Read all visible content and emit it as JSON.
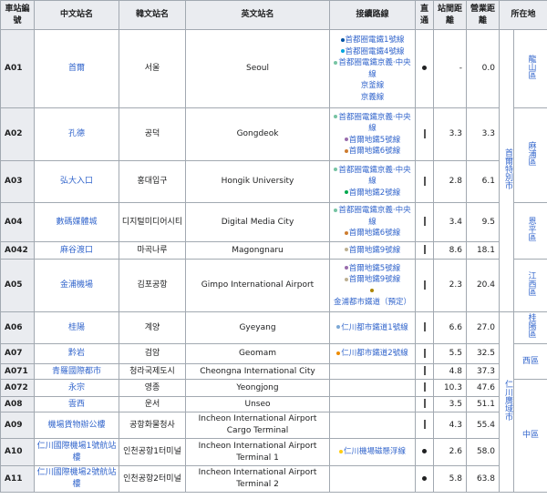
{
  "headers": {
    "code": "車站編號",
    "zh": "中文站名",
    "ko": "韓文站名",
    "en": "英文站名",
    "conn": "接續路線",
    "direct": "直通",
    "dist": "站間距離",
    "cum": "營業距離",
    "loc": "所在地"
  },
  "colors": {
    "seoul_line1": "#0052a4",
    "seoul_line4": "#00a5de",
    "gyeongui": "#77c4a3",
    "line5": "#996cac",
    "line6": "#cd7c2f",
    "line2": "#00a84d",
    "line9": "#bdb092",
    "gimpo": "#ad8605",
    "incheon1": "#7ca8d5",
    "incheon2": "#ed8b00",
    "maglev": "#ffcd12"
  },
  "rows": [
    {
      "code": "A01",
      "zh": "首爾",
      "ko": "서울",
      "en": "Seoul",
      "conns": [
        {
          "dot": "seoul_line1",
          "text": "首都圈電鐵1號線"
        },
        {
          "dot": "seoul_line4",
          "text": "首都圈電鐵4號線"
        },
        {
          "dot": "gyeongui",
          "text": "首都圈電鐵京義·中央線"
        },
        {
          "dot": "",
          "text": "京釜線"
        },
        {
          "dot": "",
          "text": "京義線"
        }
      ],
      "direct": "dot",
      "dist": "-",
      "cum": "0.0"
    },
    {
      "code": "A02",
      "zh": "孔德",
      "ko": "공덕",
      "en": "Gongdeok",
      "conns": [
        {
          "dot": "gyeongui",
          "text": "首都圈電鐵京義·中央線"
        },
        {
          "dot": "line5",
          "text": "首爾地鐵5號線"
        },
        {
          "dot": "line6",
          "text": "首爾地鐵6號線"
        }
      ],
      "direct": "bar",
      "dist": "3.3",
      "cum": "3.3"
    },
    {
      "code": "A03",
      "zh": "弘大入口",
      "ko": "홍대입구",
      "en": "Hongik University",
      "conns": [
        {
          "dot": "gyeongui",
          "text": "首都圈電鐵京義·中央線"
        },
        {
          "dot": "line2",
          "text": "首爾地鐵2號線"
        }
      ],
      "direct": "bar",
      "dist": "2.8",
      "cum": "6.1"
    },
    {
      "code": "A04",
      "zh": "數碼媒體城",
      "ko": "디지털미디어시티",
      "en": "Digital Media City",
      "conns": [
        {
          "dot": "gyeongui",
          "text": "首都圈電鐵京義·中央線"
        },
        {
          "dot": "line6",
          "text": "首爾地鐵6號線"
        }
      ],
      "direct": "bar",
      "dist": "3.4",
      "cum": "9.5"
    },
    {
      "code": "A042",
      "zh": "麻谷渡口",
      "ko": "마곡나루",
      "en": "Magongnaru",
      "conns": [
        {
          "dot": "line9",
          "text": "首爾地鐵9號線"
        }
      ],
      "direct": "bar",
      "dist": "8.6",
      "cum": "18.1"
    },
    {
      "code": "A05",
      "zh": "金浦機場",
      "ko": "김포공항",
      "en": "Gimpo International Airport",
      "conns": [
        {
          "dot": "line5",
          "text": "首爾地鐵5號線"
        },
        {
          "dot": "line9",
          "text": "首爾地鐵9號線"
        },
        {
          "dot": "gimpo",
          "text": "金浦都市鐵道（預定）"
        }
      ],
      "direct": "bar",
      "dist": "2.3",
      "cum": "20.4"
    },
    {
      "code": "A06",
      "zh": "桂陽",
      "ko": "계양",
      "en": "Gyeyang",
      "conns": [
        {
          "dot": "incheon1",
          "text": "仁川都市鐵道1號線"
        }
      ],
      "direct": "bar",
      "dist": "6.6",
      "cum": "27.0"
    },
    {
      "code": "A07",
      "zh": "黔岩",
      "ko": "검암",
      "en": "Geomam",
      "conns": [
        {
          "dot": "incheon2",
          "text": "仁川都市鐵道2號線"
        }
      ],
      "direct": "bar",
      "dist": "5.5",
      "cum": "32.5"
    },
    {
      "code": "A071",
      "zh": "青羅國際都市",
      "ko": "청라국제도시",
      "en": "Cheongna International City",
      "conns": [],
      "direct": "bar",
      "dist": "4.8",
      "cum": "37.3"
    },
    {
      "code": "A072",
      "zh": "永宗",
      "ko": "영종",
      "en": "Yeongjong",
      "conns": [],
      "direct": "bar",
      "dist": "10.3",
      "cum": "47.6"
    },
    {
      "code": "A08",
      "zh": "雲西",
      "ko": "운서",
      "en": "Unseo",
      "conns": [],
      "direct": "bar",
      "dist": "3.5",
      "cum": "51.1"
    },
    {
      "code": "A09",
      "zh": "機場貨物辦公樓",
      "ko": "공항화물청사",
      "en": "Incheon International Airport Cargo Terminal",
      "conns": [],
      "direct": "bar",
      "dist": "4.3",
      "cum": "55.4"
    },
    {
      "code": "A10",
      "zh": "仁川國際機場1號航站樓",
      "ko": "인천공항1터미널",
      "en": "Incheon International Airport Terminal 1",
      "conns": [
        {
          "dot": "maglev",
          "text": "仁川機場磁懸浮線"
        }
      ],
      "direct": "dot",
      "dist": "2.6",
      "cum": "58.0"
    },
    {
      "code": "A11",
      "zh": "仁川國際機場2號航站樓",
      "ko": "인천공항2터미널",
      "en": "Incheon International Airport Terminal 2",
      "conns": [],
      "direct": "dot",
      "dist": "5.8",
      "cum": "63.8"
    }
  ],
  "locations": {
    "seoul": "首爾特別市",
    "jongno": "龍山區",
    "mapo": "麻浦區",
    "eunpyeong": "恩平區",
    "gangseo": "江西區",
    "gyeyang": "桂陽區",
    "seogu": "西區",
    "incheon": "仁川廣域市",
    "junggu": "中區"
  }
}
